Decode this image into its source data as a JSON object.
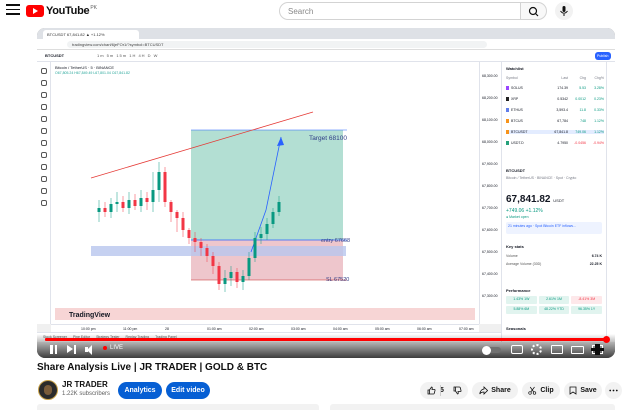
{
  "youtube": {
    "logo_text": "YouTube",
    "logo_sup": "PK",
    "search_placeholder": "Search"
  },
  "browser": {
    "tab_title": "BTCUSDT 67,841.82 ▲ +1.12%",
    "url": "tradingview.com/chart/6jeFOr1/?symbol=BTCUSDT"
  },
  "tradingview": {
    "symbol": "BTCUSDT",
    "timeframes": "1m  5m  15m  1H  4H  D  W",
    "publish_label": "Publish",
    "pair_title": "Bitcoin / TetherUS · 5 · BINANCE",
    "ohlc": "O67,805.24 H67,849.49 L67,801.04 C67,841.82",
    "watermark": "TradingView",
    "target_label": "Target 68100",
    "entry_label": "entry 67668",
    "sl_label": "SL 67520",
    "price_ticks": [
      "68,300.00",
      "68,200.00",
      "68,100.00",
      "68,000.00",
      "67,900.00",
      "67,800.00",
      "67,700.00",
      "67,600.00",
      "67,500.00",
      "67,400.00",
      "67,300.00"
    ],
    "time_ticks": [
      "10:00 pm",
      "11:00 pm",
      "28",
      "01:00 am",
      "02:00 am",
      "03:00 am",
      "04:00 am",
      "05:00 am",
      "06:00 am",
      "07:00 am"
    ],
    "bottom_tabs": [
      "Stock Screener",
      "Pine Editor",
      "Strategy Tester",
      "Replay Trading",
      "Trading Panel"
    ],
    "watchlist": {
      "title": "Watchlist",
      "headers": [
        "Symbol",
        "Last",
        "Chg",
        "Chg%"
      ],
      "rows": [
        {
          "symbol": "SOLUS",
          "last": "174.39",
          "chg": "5.53",
          "pct": "3.28%"
        },
        {
          "symbol": "XRP",
          "last": "0.5342",
          "chg": "0.0012",
          "pct": "0.23%"
        },
        {
          "symbol": "ETHUS",
          "last": "3,593.4",
          "chg": "11.8",
          "pct": "0.33%"
        },
        {
          "symbol": "BTCUS",
          "last": "67,784",
          "chg": "748",
          "pct": "1.12%"
        },
        {
          "symbol": "BTCUSDT",
          "last": "67,841.8",
          "chg": "749.06",
          "pct": "1.12%"
        },
        {
          "symbol": "USDT.D",
          "last": "4.7950",
          "chg": "-0.0456",
          "pct": "-0.94%"
        }
      ]
    },
    "detail": {
      "symbol": "BTCUSDT",
      "name": "Bitcoin / TetherUS · BINANCE · Spot · Crypto",
      "price": "67,841.82",
      "currency": "USDT",
      "change": "+749.06  +1.12%",
      "status": "● Market open",
      "news": "21 minutes ago · Spot Bitcoin ETF inflows...",
      "key_stats_title": "Key stats",
      "volume_label": "Volume",
      "volume_value": "6.74 K",
      "avg_volume_label": "Average Volume (30D)",
      "avg_volume_value": "22.25 K",
      "performance_title": "Performance",
      "performance": [
        {
          "value": "1.43%",
          "period": "1W"
        },
        {
          "value": "2.61%",
          "period": "1M"
        },
        {
          "value": "-8.41%",
          "period": "3M"
        },
        {
          "value": "5.88%",
          "period": "6M"
        },
        {
          "value": "48.22%",
          "period": "YTD"
        },
        {
          "value": "96.35%",
          "period": "1Y"
        }
      ],
      "seasonals_title": "Seasonals"
    }
  },
  "player": {
    "live_label": "LIVE"
  },
  "video": {
    "title": "Share Analysis Live | JR TRADER | GOLD & BTC",
    "channel": "JR TRADER",
    "subscribers": "1.22K subscribers",
    "analytics_label": "Analytics",
    "edit_label": "Edit video",
    "like_count": "5",
    "share_label": "Share",
    "clip_label": "Clip",
    "save_label": "Save"
  },
  "colors": {
    "target_zone": "#9ad4c4",
    "stop_zone": "#e8b3bb",
    "entry_line": "#2962ff",
    "trendline": "#e53935",
    "accent_red": "#ff0000",
    "youtube_blue": "#065fd4"
  }
}
